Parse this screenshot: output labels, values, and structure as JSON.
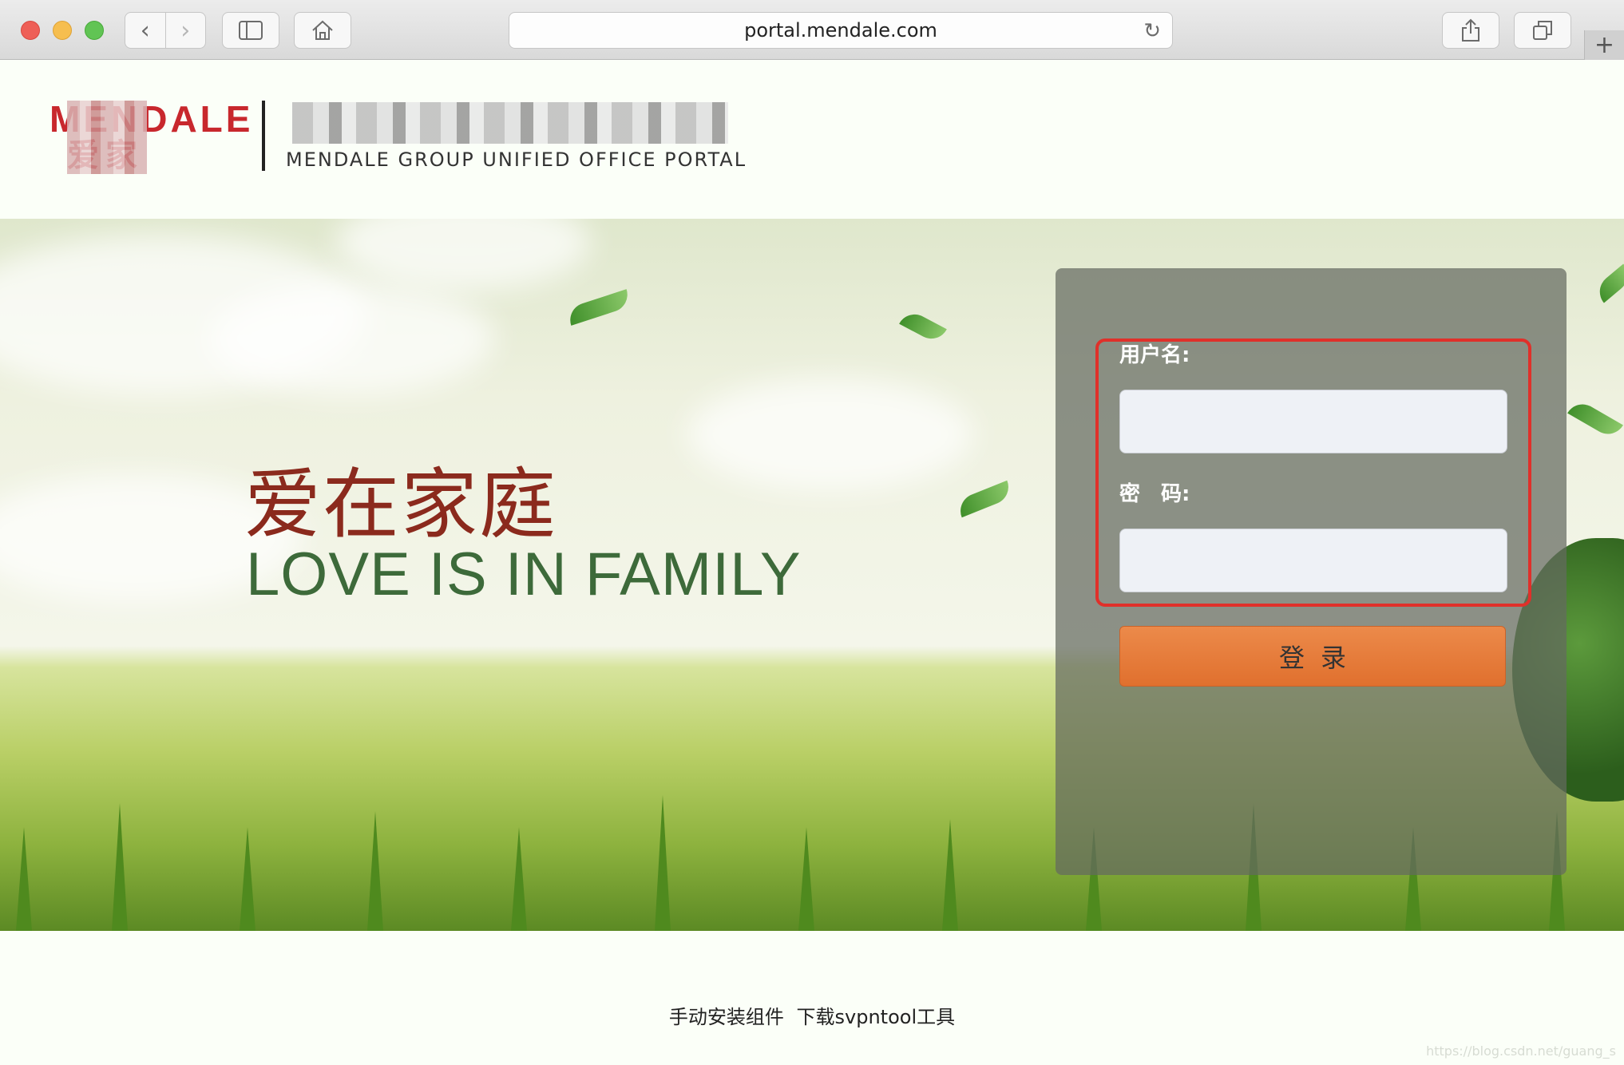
{
  "browser": {
    "url": "portal.mendale.com",
    "icons": {
      "back": "chevron-left-icon",
      "forward": "chevron-right-icon",
      "sidebar": "sidebar-icon",
      "home": "home-icon",
      "reload": "reload-icon",
      "share": "share-icon",
      "tabs": "tabs-icon",
      "new_tab": "plus-icon"
    }
  },
  "header": {
    "logo_top": "MENDALE",
    "logo_bottom": "爱家",
    "portal_subtitle": "MENDALE GROUP UNIFIED OFFICE PORTAL"
  },
  "banner": {
    "slogan_cn": "爱在家庭",
    "slogan_en": "LOVE IS IN FAMILY"
  },
  "login": {
    "username_label": "用户名:",
    "username_value": "",
    "password_label": "密　码:",
    "password_value": "",
    "submit_label": "登录"
  },
  "footer": {
    "link_manual_install": "手动安装组件",
    "link_download_tool": "下载svpntool工具",
    "watermark": "https://blog.csdn.net/guang_s"
  },
  "colors": {
    "brand_red": "#c8282d",
    "slogan_red": "#8b2a1d",
    "slogan_green": "#3d6a3a",
    "button_orange": "#e57a38",
    "highlight_red": "#e0302a"
  }
}
